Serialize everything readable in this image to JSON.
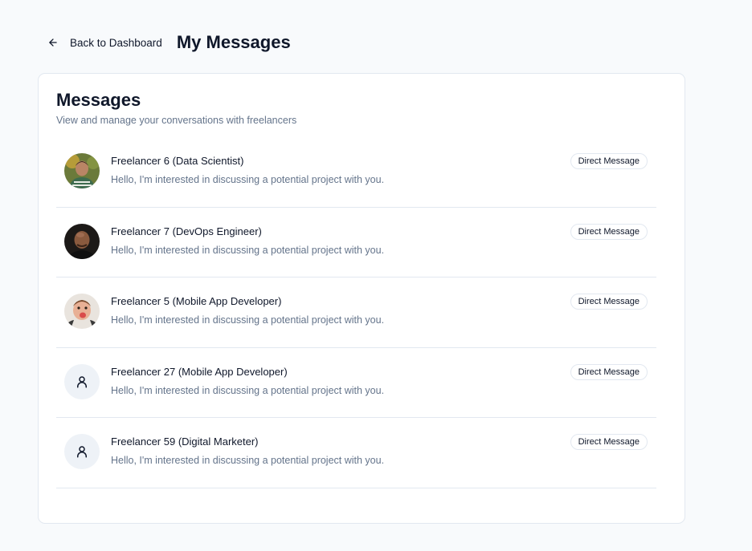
{
  "header": {
    "back_label": "Back to Dashboard",
    "title": "My Messages"
  },
  "card": {
    "title": "Messages",
    "description": "View and manage your conversations with freelancers"
  },
  "conversations": [
    {
      "name": "Freelancer 6 (Data Scientist)",
      "preview": "Hello, I'm interested in discussing a potential project with you.",
      "badge": "Direct Message",
      "avatar": "photo"
    },
    {
      "name": "Freelancer 7 (DevOps Engineer)",
      "preview": "Hello, I'm interested in discussing a potential project with you.",
      "badge": "Direct Message",
      "avatar": "photo"
    },
    {
      "name": "Freelancer 5 (Mobile App Developer)",
      "preview": "Hello, I'm interested in discussing a potential project with you.",
      "badge": "Direct Message",
      "avatar": "photo"
    },
    {
      "name": "Freelancer 27 (Mobile App Developer)",
      "preview": "Hello, I'm interested in discussing a potential project with you.",
      "badge": "Direct Message",
      "avatar": "user-icon"
    },
    {
      "name": "Freelancer 59 (Digital Marketer)",
      "preview": "Hello, I'm interested in discussing a potential project with you.",
      "badge": "Direct Message",
      "avatar": "user-icon"
    }
  ]
}
